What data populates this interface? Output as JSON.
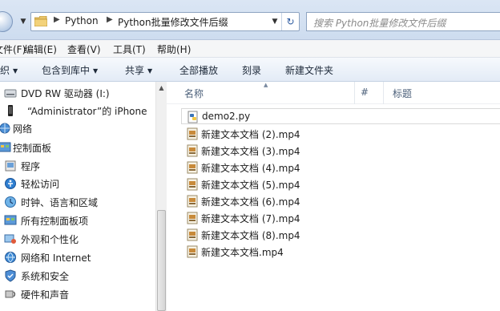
{
  "address_bar": {
    "breadcrumbs": [
      "Python",
      "Python批量修改文件后缀"
    ],
    "search_placeholder": "搜索 Python批量修改文件后缀"
  },
  "menu": [
    "文件(F)",
    "编辑(E)",
    "查看(V)",
    "工具(T)",
    "帮助(H)"
  ],
  "toolbar": {
    "organize_partial": "织",
    "include_library": "包含到库中",
    "share": "共享",
    "play_all": "全部播放",
    "burn": "刻录",
    "new_folder": "新建文件夹"
  },
  "nav_pane": {
    "items": [
      {
        "label": "DVD RW 驱动器 (I:)",
        "icon": "dvd-drive-icon"
      },
      {
        "label": "“Administrator”的 iPhone",
        "icon": "phone-icon"
      },
      {
        "label": "网络",
        "icon": "network-icon"
      },
      {
        "label": "控制面板",
        "icon": "control-panel-icon"
      },
      {
        "label": "程序",
        "icon": "programs-icon"
      },
      {
        "label": "轻松访问",
        "icon": "ease-of-access-icon"
      },
      {
        "label": "时钟、语言和区域",
        "icon": "clock-globe-icon"
      },
      {
        "label": "所有控制面板项",
        "icon": "control-panel-items-icon"
      },
      {
        "label": "外观和个性化",
        "icon": "appearance-icon"
      },
      {
        "label": "网络和 Internet",
        "icon": "network-internet-icon"
      },
      {
        "label": "系统和安全",
        "icon": "system-security-icon"
      },
      {
        "label": "硬件和声音",
        "icon": "hardware-sound-icon"
      }
    ]
  },
  "file_pane": {
    "columns": [
      "名称",
      "#",
      "标题"
    ],
    "files": [
      {
        "name": "demo2.py",
        "icon": "python-file-icon"
      },
      {
        "name": "新建文本文档 (2).mp4",
        "icon": "video-file-icon"
      },
      {
        "name": "新建文本文档 (3).mp4",
        "icon": "video-file-icon"
      },
      {
        "name": "新建文本文档 (4).mp4",
        "icon": "video-file-icon"
      },
      {
        "name": "新建文本文档 (5).mp4",
        "icon": "video-file-icon"
      },
      {
        "name": "新建文本文档 (6).mp4",
        "icon": "video-file-icon"
      },
      {
        "name": "新建文本文档 (7).mp4",
        "icon": "video-file-icon"
      },
      {
        "name": "新建文本文档 (8).mp4",
        "icon": "video-file-icon"
      },
      {
        "name": "新建文本文档.mp4",
        "icon": "video-file-icon"
      }
    ]
  }
}
